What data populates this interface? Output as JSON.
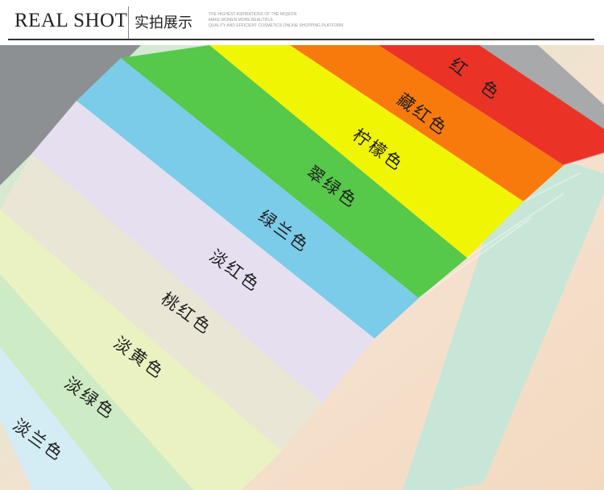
{
  "header": {
    "title_en": "REAL SHOT",
    "title_cn": "实拍展示",
    "tagline": [
      "THE HIGHEST ASPIRATIONS OF THE MIQEON",
      "MAKE WOMEN MORE BEAUTIFUL",
      "QUALITY AND EFFICIENT COSMETICS ONLINE SHOPPING PLATFORM"
    ]
  },
  "tabs": [
    {
      "label": "红　色",
      "color": "#ea3326"
    },
    {
      "label": "藏红色",
      "color": "#f97a0c"
    },
    {
      "label": "柠檬色",
      "color": "#f0f504"
    },
    {
      "label": "翠绿色",
      "color": "#56c84a"
    },
    {
      "label": "绿兰色",
      "color": "#7bcce8"
    },
    {
      "label": "淡红色",
      "color": "#e6dff0"
    },
    {
      "label": "桃红色",
      "color": "#e9e6d6"
    },
    {
      "label": "淡黄色",
      "color": "#eaf2c2"
    },
    {
      "label": "淡绿色",
      "color": "#cdebc4"
    },
    {
      "label": "淡兰色",
      "color": "#d4ecf4"
    }
  ]
}
